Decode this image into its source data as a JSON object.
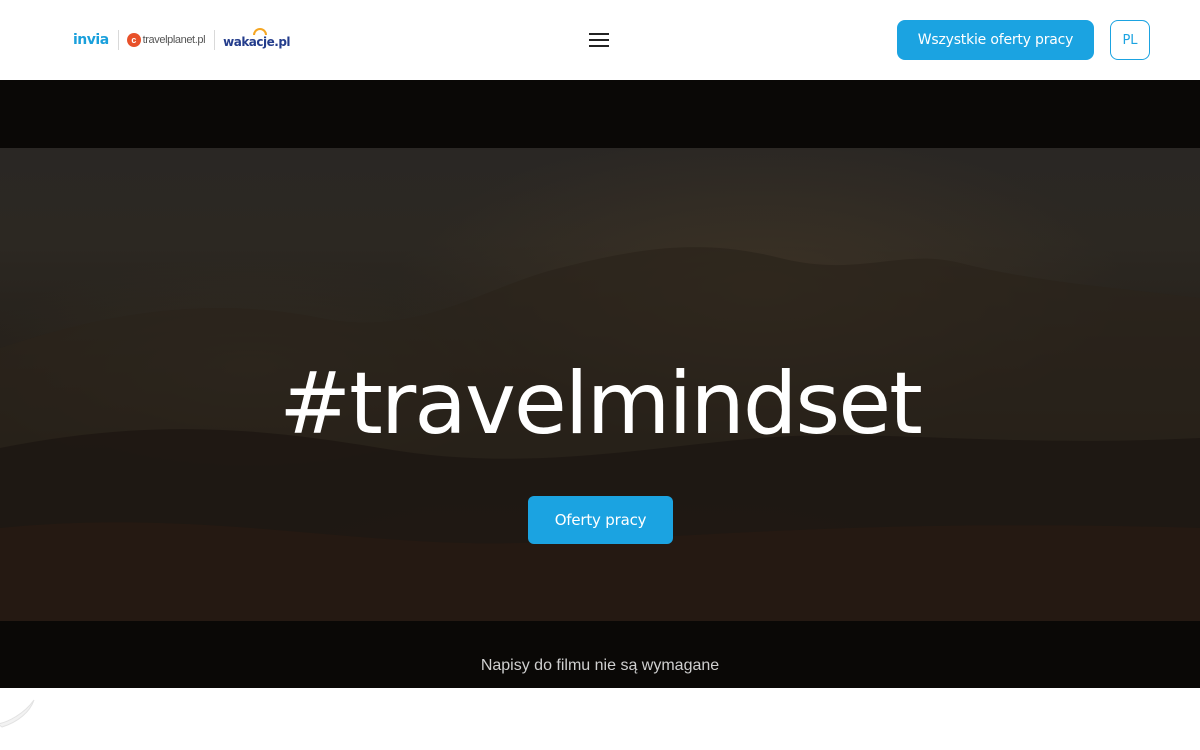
{
  "header": {
    "logos": {
      "invia": "invia",
      "travelplanet": "travelplanet",
      "travelplanet_suffix": ".pl",
      "wakacje": "wakacje.pl"
    },
    "menu_icon": "hamburger-menu-icon",
    "all_offers_label": "Wszystkie oferty pracy",
    "language_label": "PL"
  },
  "hero": {
    "title": "#travelmindset",
    "cta_label": "Oferty pracy",
    "caption": "Napisy do filmu nie są wymagane"
  },
  "colors": {
    "accent": "#1ba3e1",
    "header_bg": "#ffffff",
    "video_bg": "#0a0806",
    "title_text": "#ffffff"
  }
}
